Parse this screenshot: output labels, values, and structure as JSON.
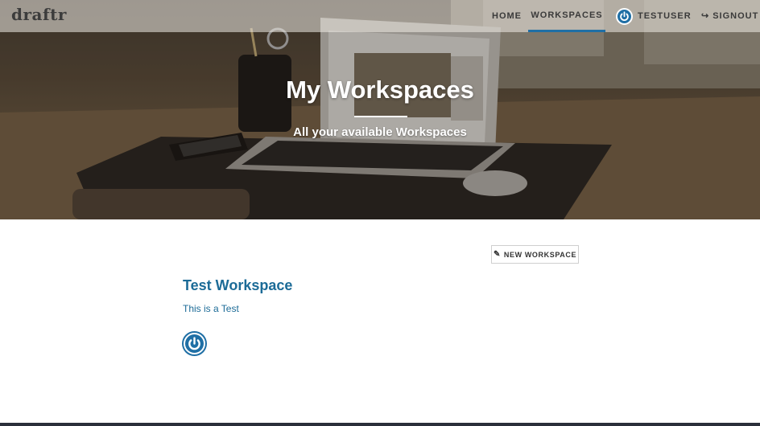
{
  "navbar": {
    "brand": "draftr",
    "items": [
      {
        "label": "HOME"
      },
      {
        "label": "WORKSPACES",
        "active": true
      },
      {
        "label": "TESTUSER",
        "icon": "power-icon"
      },
      {
        "label": "SIGNOUT",
        "icon": "signout-icon"
      }
    ]
  },
  "hero": {
    "title": "My Workspaces",
    "subtitle": "All your available Workspaces"
  },
  "toolbar": {
    "new_workspace_label": "NEW WORKSPACE",
    "new_workspace_icon": "pencil-icon"
  },
  "workspaces": [
    {
      "title": "Test Workspace",
      "description": "This is a Test",
      "member_icon": "power-icon"
    }
  ],
  "colors": {
    "accent": "#1f6fa5",
    "link": "#1c6b97"
  }
}
